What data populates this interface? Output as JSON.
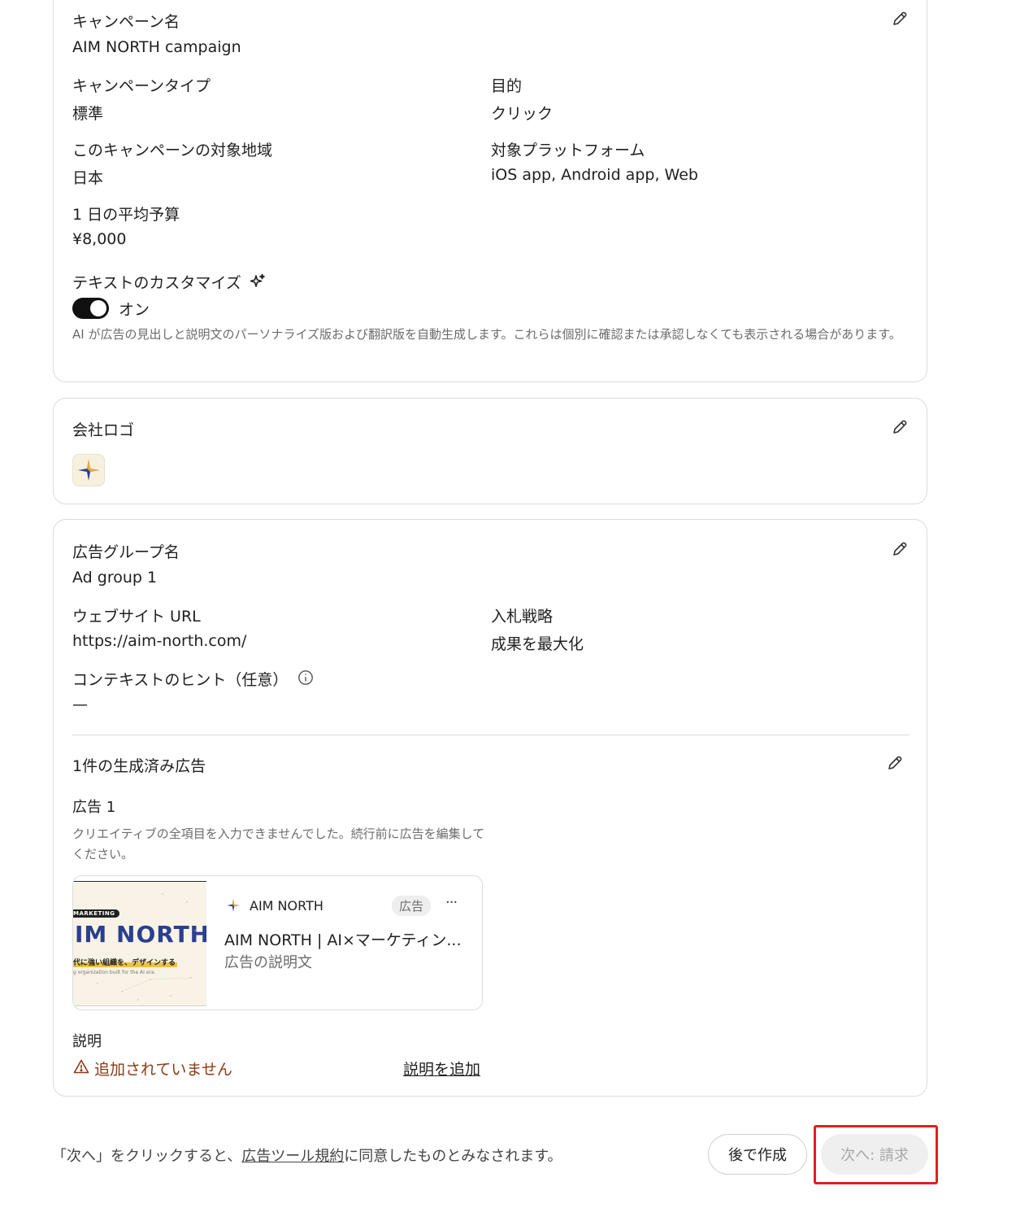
{
  "campaign": {
    "name_label": "キャンペーン名",
    "name_value": "AIM NORTH campaign",
    "type_label": "キャンペーンタイプ",
    "type_value": "標準",
    "objective_label": "目的",
    "objective_value": "クリック",
    "region_label": "このキャンペーンの対象地域",
    "region_value": "日本",
    "platform_label": "対象プラットフォーム",
    "platform_value": "iOS app, Android app, Web",
    "budget_label": "1 日の平均予算",
    "budget_value": "¥8,000",
    "text_custom_label": "テキストのカスタマイズ",
    "toggle_label": "オン",
    "toggle_on": true,
    "ai_note": "AI が広告の見出しと説明文のパーソナライズ版および翻訳版を自動生成します。これらは個別に確認または承認しなくても表示される場合があります。"
  },
  "logo": {
    "label": "会社ロゴ"
  },
  "adgroup": {
    "name_label": "広告グループ名",
    "name_value": "Ad group 1",
    "url_label": "ウェブサイト URL",
    "url_value": "https://aim-north.com/",
    "bid_label": "入札戦略",
    "bid_value": "成果を最大化",
    "hint_label": "コンテキストのヒント（任意）",
    "hint_value": "—",
    "generated_label": "1件の生成済み広告",
    "ad_title": "広告 1",
    "ad_warning": "クリエイティブの全項目を入力できませんでした。続行前に広告を編集してください。",
    "preview": {
      "brand": "AIM NORTH",
      "badge": "広告",
      "more": "···",
      "headline": "AIM NORTH | AI×マーケティン...",
      "description": "広告の説明文",
      "thumb_tag": "MARKETING",
      "thumb_title": "IM NORTH",
      "thumb_sub": "代に強い組織を、デザインする",
      "thumb_en": "g organization built for the AI era."
    },
    "desc_label": "説明",
    "desc_missing": "追加されていません",
    "desc_add": "説明を追加"
  },
  "footer": {
    "terms_prefix": "「次へ」をクリックすると、",
    "terms_link": "広告ツール規約",
    "terms_suffix": "に同意したものとみなされます。",
    "later_button": "後で作成",
    "next_button": "次へ: 請求"
  },
  "colors": {
    "warning": "#8a3b12",
    "highlight": "#e02020",
    "star_gold": "#e8a93a",
    "star_navy": "#2a3f8f"
  }
}
